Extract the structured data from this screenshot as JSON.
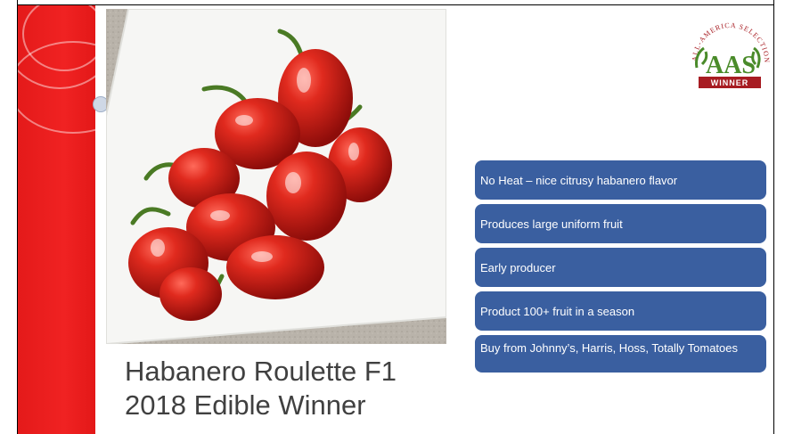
{
  "slide": {
    "title_line1": "Habanero Roulette F1",
    "title_line2": "2018 Edible Winner"
  },
  "logo": {
    "top_text": "ALL-AMERICA SELECTIONS",
    "letters": "AAS",
    "badge_text": "WINNER"
  },
  "bullets": [
    {
      "text": "No Heat – nice citrusy habanero flavor"
    },
    {
      "text": "Produces large uniform fruit"
    },
    {
      "text": "Early producer"
    },
    {
      "text": "Product 100+ fruit in a season"
    },
    {
      "text": "Buy from Johnny’s, Harris, Hoss, Totally Tomatoes"
    }
  ],
  "photo": {
    "icon": "habanero-peppers-photo"
  },
  "colors": {
    "red_band": "#e41a1a",
    "bullet_bg": "#3a5fa0",
    "title_text": "#404040",
    "logo_red": "#a71c22",
    "logo_green": "#4a8b2a"
  }
}
